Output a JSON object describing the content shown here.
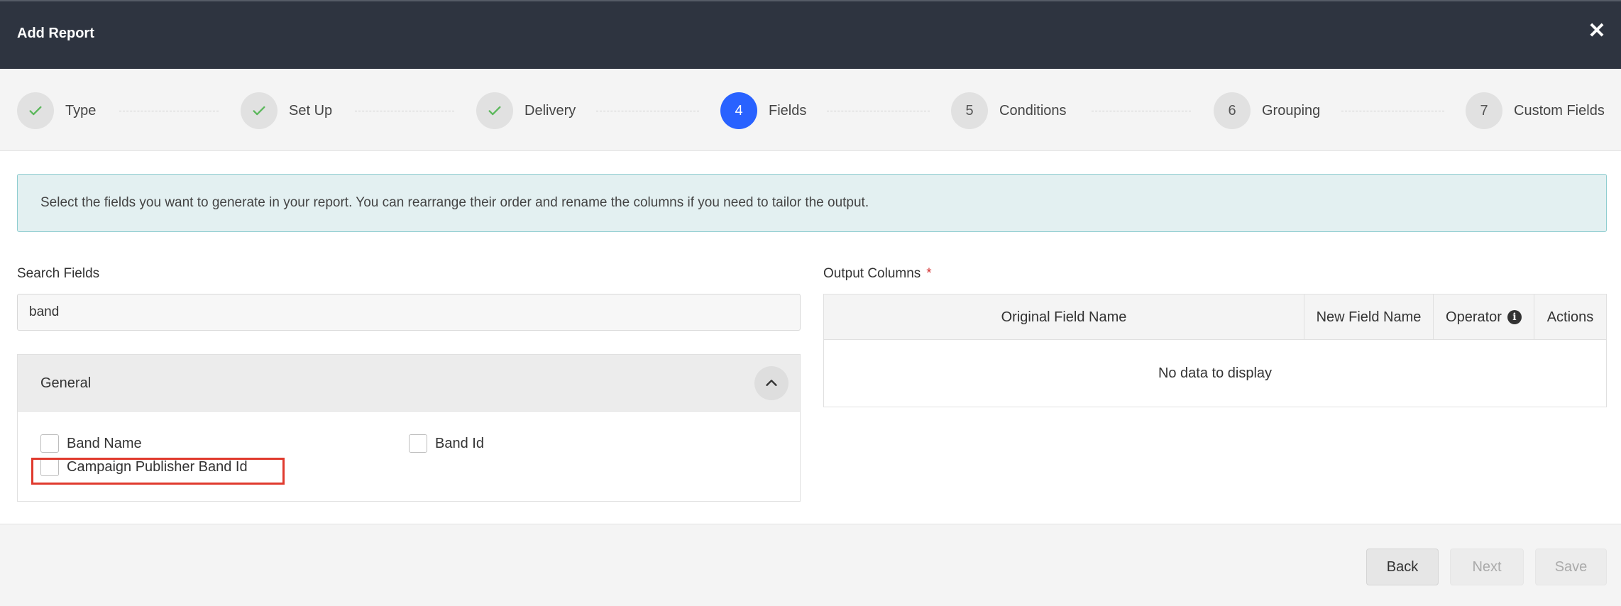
{
  "dialog": {
    "title": "Add Report",
    "close_icon": "close-icon"
  },
  "steps": [
    {
      "label": "Type",
      "state": "done"
    },
    {
      "label": "Set Up",
      "state": "done"
    },
    {
      "label": "Delivery",
      "state": "done"
    },
    {
      "number": "4",
      "label": "Fields",
      "state": "active"
    },
    {
      "number": "5",
      "label": "Conditions",
      "state": "pending"
    },
    {
      "number": "6",
      "label": "Grouping",
      "state": "pending"
    },
    {
      "number": "7",
      "label": "Custom Fields",
      "state": "pending"
    }
  ],
  "info_text": "Select the fields you want to generate in your report. You can rearrange their order and rename the columns if you need to tailor the output.",
  "search": {
    "label": "Search Fields",
    "value": "band"
  },
  "group": {
    "title": "General",
    "fields": [
      "Band Name",
      "Band Id",
      "Campaign Publisher Band Id"
    ]
  },
  "output": {
    "label": "Output Columns",
    "required_mark": "*",
    "columns": [
      "Original Field Name",
      "New Field Name",
      "Operator",
      "Actions"
    ],
    "empty_text": "No data to display"
  },
  "footer": {
    "back": "Back",
    "next": "Next",
    "save": "Save"
  },
  "colors": {
    "header_bg": "#2e3440",
    "accent": "#2962ff",
    "check": "#5cb85c",
    "highlight": "#e03a2e"
  }
}
